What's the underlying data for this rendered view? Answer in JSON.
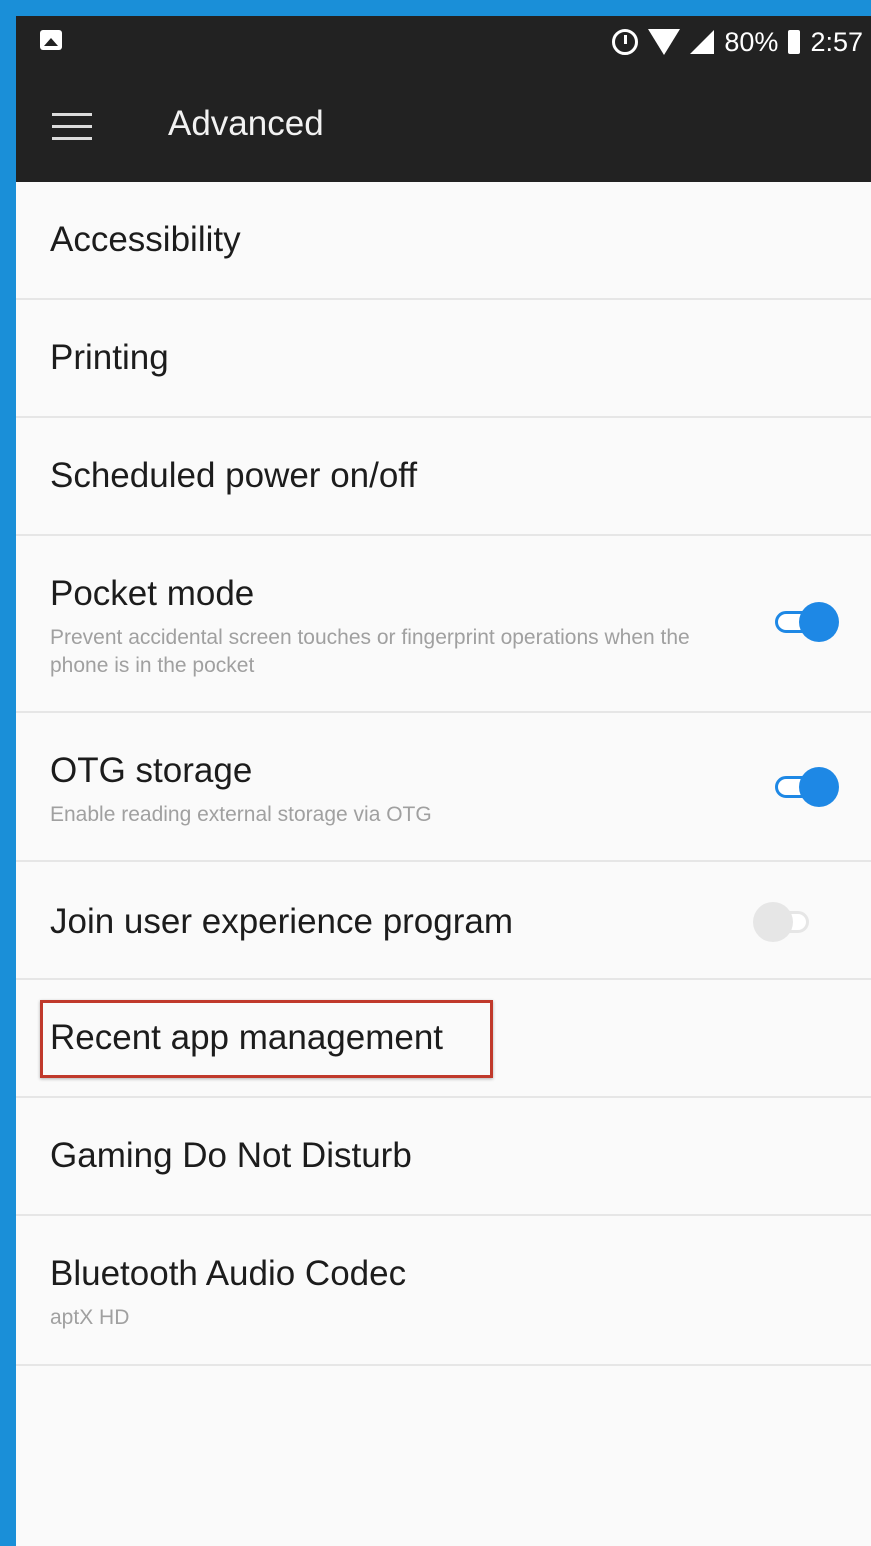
{
  "status_bar": {
    "battery": "80%",
    "time": "2:57",
    "icons": [
      "image-icon",
      "alarm-icon",
      "wifi-icon",
      "signal-icon",
      "battery-icon"
    ]
  },
  "toolbar": {
    "title": "Advanced",
    "menu_icon": "hamburger-menu-icon"
  },
  "items": [
    {
      "title": "Accessibility"
    },
    {
      "title": "Printing"
    },
    {
      "title": "Scheduled power on/off"
    },
    {
      "title": "Pocket mode",
      "subtitle": "Prevent accidental screen touches or fingerprint operations when the phone is in the pocket",
      "toggle": true
    },
    {
      "title": "OTG storage",
      "subtitle": "Enable reading external storage via OTG",
      "toggle": true
    },
    {
      "title": "Join user experience program",
      "toggle": false
    },
    {
      "title": "Recent app management",
      "highlighted": true
    },
    {
      "title": "Gaming Do Not Disturb"
    },
    {
      "title": "Bluetooth Audio Codec",
      "subtitle": "aptX HD"
    }
  ],
  "colors": {
    "accent": "#1e88e5",
    "toolbar_bg": "#222222",
    "highlight": "#c0392b",
    "frame": "#1a8fd8"
  }
}
